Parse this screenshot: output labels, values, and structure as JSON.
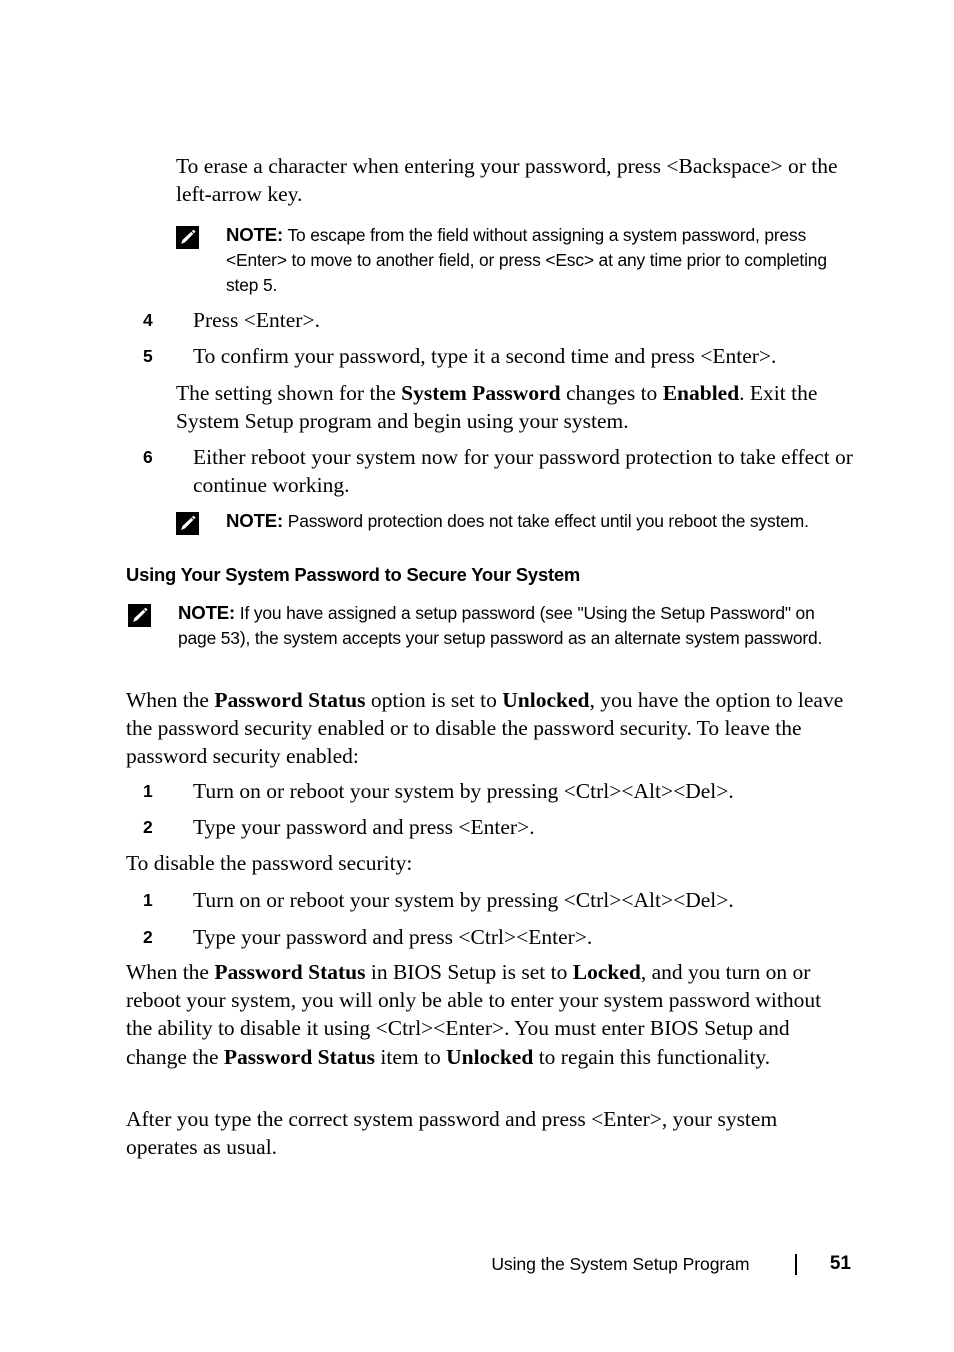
{
  "document": {
    "title": "Using the System Setup Program",
    "page_number": "51"
  },
  "content": {
    "intro_paragraph": "To erase a character when entering your password, press <Backspace> or the left-arrow key.",
    "note_1": {
      "icon": "note-pencil-icon",
      "label": "NOTE:",
      "text": "To escape from the field without assigning a system password, press <Enter> to move to another field, or press <Esc> at any time prior to completing step 5."
    },
    "steps_a": [
      {
        "number": "4",
        "text": "Press <Enter>."
      },
      {
        "number": "5",
        "text": "To confirm your password, type it a second time and press <Enter>."
      },
      {
        "number": "6",
        "text": "Either reboot your system now for your password protection to take effect or continue working."
      }
    ],
    "step5_followup": {
      "part1": "The setting shown for the ",
      "bold1": "System Password",
      "part2": " changes to ",
      "bold2": "Enabled",
      "part3": ". Exit the System Setup program and begin using your system."
    },
    "note_2": {
      "icon": "note-pencil-icon",
      "label": "NOTE:",
      "text": "Password protection does not take effect until you reboot the system."
    },
    "heading": "Using Your System Password to Secure Your System",
    "note_3": {
      "icon": "note-pencil-icon",
      "label": "NOTE:",
      "text": "If you have assigned a setup password (see \"Using the Setup Password\" on page 53), the system accepts your setup password as an alternate system password."
    },
    "paragraph_unlocked": {
      "part1": "When the ",
      "bold1": "Password Status",
      "part2": " option is set to ",
      "bold2": "Unlocked",
      "part3": ", you have the option to leave the password security enabled or to disable the password security. To leave the password security enabled:"
    },
    "steps_b": [
      {
        "number": "1",
        "text": "Turn on or reboot your system by pressing <Ctrl><Alt><Del>."
      },
      {
        "number": "2",
        "text": "Type your password and press <Enter>."
      }
    ],
    "paragraph_disable": "To disable the password security:",
    "steps_c": [
      {
        "number": "1",
        "text": "Turn on or reboot your system by pressing <Ctrl><Alt><Del>."
      },
      {
        "number": "2",
        "text": "Type your password and press <Ctrl><Enter>."
      }
    ],
    "paragraph_locked": {
      "part1": "When the ",
      "bold1": "Password Status",
      "part2": " in BIOS Setup is set to ",
      "bold2": "Locked",
      "part3": ", and you turn on or reboot your system, you will only be able to enter your system password without the ability to disable it using <Ctrl><Enter>. You must enter BIOS Setup and change the ",
      "bold3": "Password Status",
      "part4": " item to ",
      "bold4": "Unlocked",
      "part5": " to regain this functionality."
    },
    "paragraph_final": "After you type the correct system password and press <Enter>, your system operates as usual."
  }
}
